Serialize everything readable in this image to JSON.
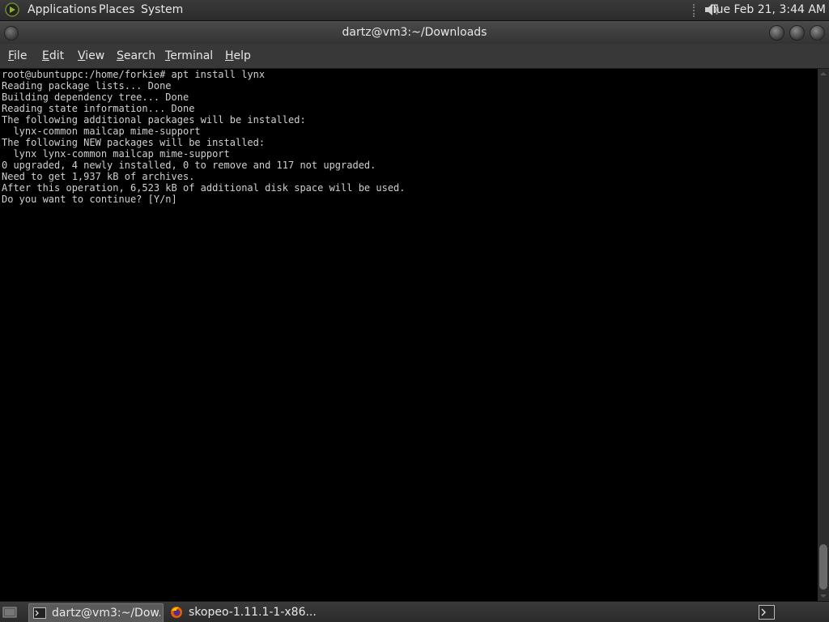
{
  "top_panel": {
    "menus": [
      "Applications",
      "Places",
      "System"
    ],
    "clock": "Tue Feb 21,  3:44 AM"
  },
  "window": {
    "title": "dartz@vm3:~/Downloads",
    "menubar": [
      {
        "u": "F",
        "rest": "ile"
      },
      {
        "u": "E",
        "rest": "dit"
      },
      {
        "u": "V",
        "rest": "iew"
      },
      {
        "u": "S",
        "rest": "earch"
      },
      {
        "u": "T",
        "rest": "erminal"
      },
      {
        "u": "H",
        "rest": "elp"
      }
    ]
  },
  "terminal": {
    "lines": [
      "root@ubuntuppc:/home/forkie# apt install lynx",
      "Reading package lists... Done",
      "Building dependency tree... Done",
      "Reading state information... Done",
      "The following additional packages will be installed:",
      "  lynx-common mailcap mime-support",
      "The following NEW packages will be installed:",
      "  lynx lynx-common mailcap mime-support",
      "0 upgraded, 4 newly installed, 0 to remove and 117 not upgraded.",
      "Need to get 1,937 kB of archives.",
      "After this operation, 6,523 kB of additional disk space will be used.",
      "Do you want to continue? [Y/n]"
    ]
  },
  "taskbar": {
    "tasks": [
      {
        "label": "dartz@vm3:~/Dow...",
        "icon": "terminal-icon",
        "active": true
      },
      {
        "label": "skopeo-1.11.1-1-x86...",
        "icon": "firefox-icon",
        "active": false
      }
    ]
  },
  "colors": {
    "terminal_bg": "#000000",
    "terminal_fg": "#d0d0d0",
    "panel_bg": "#2b2b2b"
  }
}
